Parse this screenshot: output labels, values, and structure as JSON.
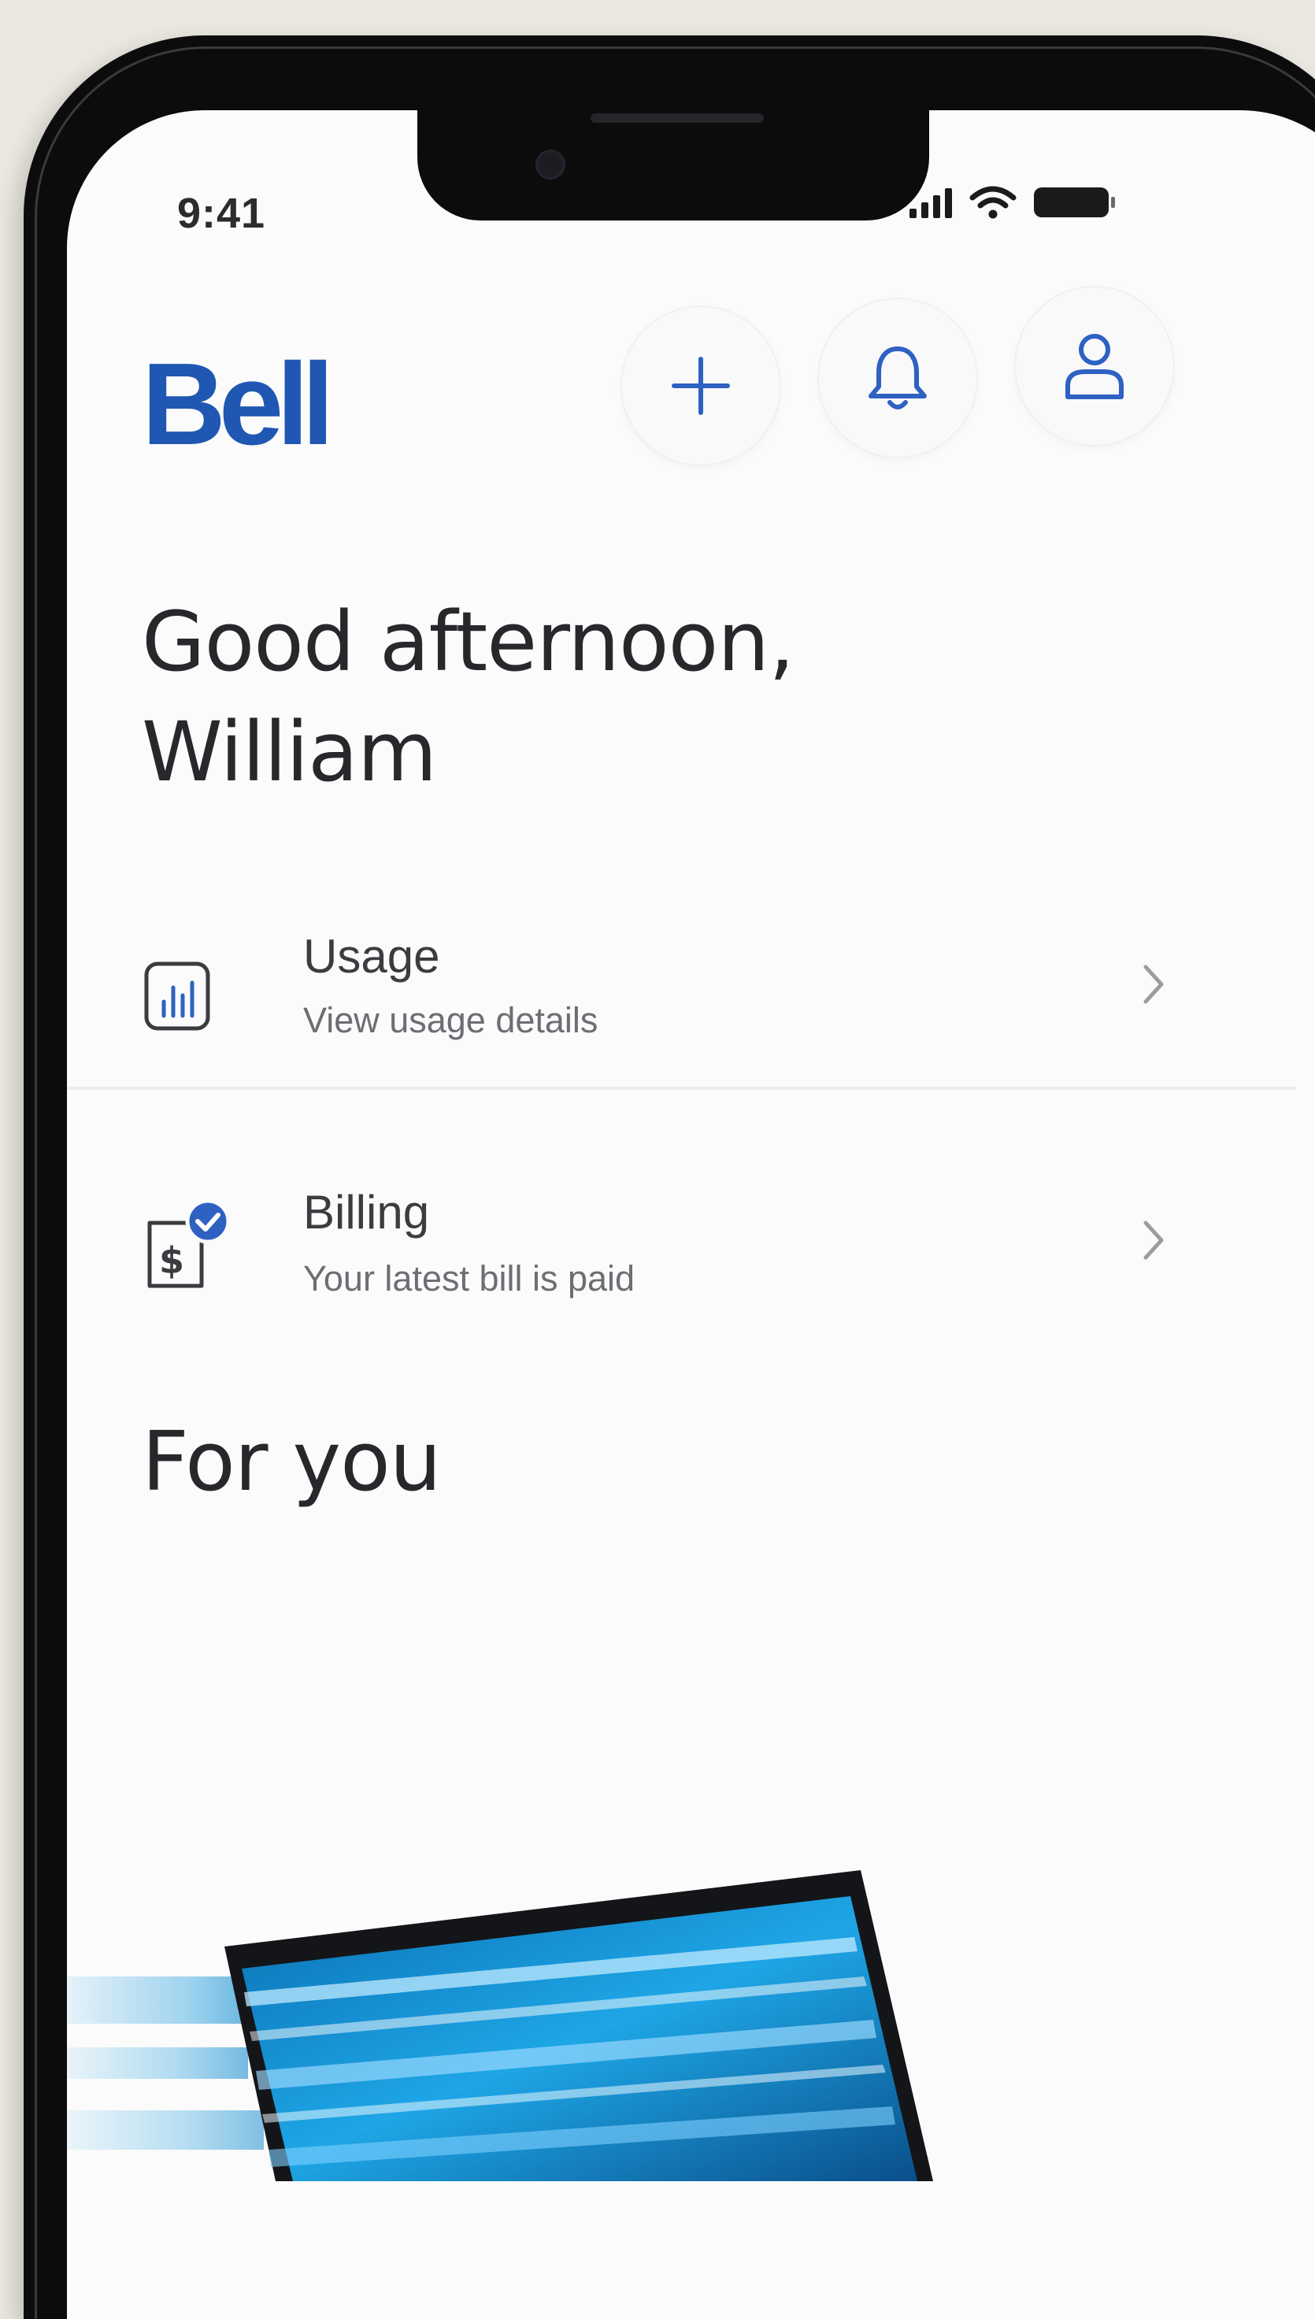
{
  "status_bar": {
    "time": "9:41"
  },
  "header": {
    "logo_text": "Bell",
    "actions": [
      {
        "id": "add",
        "icon": "plus-icon"
      },
      {
        "id": "notifications",
        "icon": "bell-icon"
      },
      {
        "id": "profile",
        "icon": "user-icon"
      }
    ]
  },
  "greeting": {
    "line1": "Good afternoon,",
    "line2": "William"
  },
  "list": [
    {
      "title": "Usage",
      "subtitle": "View usage details",
      "icon": "usage-chart-icon"
    },
    {
      "title": "Billing",
      "subtitle": "Your latest bill is paid",
      "icon": "bill-paid-icon"
    }
  ],
  "for_you": {
    "title": "For you",
    "promo_icon": "laptop-image"
  },
  "colors": {
    "brand_blue": "#1f57b3",
    "icon_blue": "#2e61c2",
    "page_background": "#ebe8e1",
    "screen_background": "#fbfbfb",
    "text_dark": "#27282b",
    "text_muted": "#6c6e73"
  }
}
